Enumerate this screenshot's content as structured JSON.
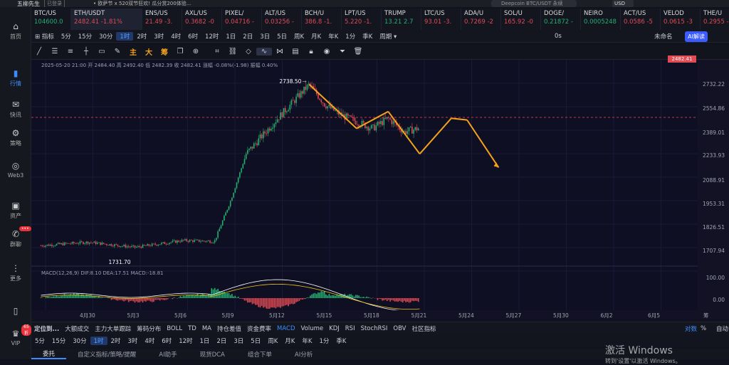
{
  "topbar": {
    "user": "五柳先生",
    "status": "已登录",
    "notice": "• 欧萨节 x 520双节狂欢! 瓜分赏200体验...",
    "search_placeholder": "Deepcoin BTC/USDT 永续",
    "currency": "USD"
  },
  "sidebar": {
    "items": [
      {
        "label": "首页",
        "icon": "home-icon"
      },
      {
        "label": "行情",
        "icon": "market-icon"
      },
      {
        "label": "快讯",
        "icon": "news-icon"
      },
      {
        "label": "策略",
        "icon": "strategy-icon"
      },
      {
        "label": "Web3",
        "icon": "web3-icon"
      },
      {
        "label": "资产",
        "icon": "wallet-icon"
      },
      {
        "label": "群聊",
        "icon": "chat-icon",
        "badge": "•••"
      },
      {
        "label": "更多",
        "icon": "more-icon"
      },
      {
        "label": "",
        "icon": "phone-icon"
      },
      {
        "label": "VIP",
        "icon": "vip-icon",
        "badge": "65折"
      }
    ]
  },
  "tickers": [
    {
      "name": "BTC/US",
      "value": "104600.0",
      "dir": "up"
    },
    {
      "name": "ETH/USDT",
      "value": "2482.41  -1.81%",
      "dir": "dn",
      "selected": true
    },
    {
      "name": "ENS/US",
      "value": "21.49 -3.",
      "dir": "dn"
    },
    {
      "name": "AXL/US",
      "value": "0.3682 -0",
      "dir": "dn"
    },
    {
      "name": "PIXEL/",
      "value": "0.04716 -",
      "dir": "dn"
    },
    {
      "name": "ALT/US",
      "value": "0.03256 -",
      "dir": "dn"
    },
    {
      "name": "BCH/U",
      "value": "386.8 -1.",
      "dir": "dn"
    },
    {
      "name": "LPT/US",
      "value": "5.220 -1.",
      "dir": "dn"
    },
    {
      "name": "TRUMP",
      "value": "13.21 2.7",
      "dir": "up"
    },
    {
      "name": "LTC/US",
      "value": "93.01 -3.",
      "dir": "dn"
    },
    {
      "name": "ADA/U",
      "value": "0.7269 -2",
      "dir": "dn"
    },
    {
      "name": "SOL/U",
      "value": "165.92 -0",
      "dir": "dn"
    },
    {
      "name": "DOGE/",
      "value": "0.21872 -",
      "dir": "up"
    },
    {
      "name": "NEIRO",
      "value": "0.0005248",
      "dir": "up"
    },
    {
      "name": "ACT/US",
      "value": "0.0586 -5",
      "dir": "dn"
    },
    {
      "name": "VELOD",
      "value": "0.0615 -3",
      "dir": "dn"
    },
    {
      "name": "THE/U",
      "value": "0.2955 -2",
      "dir": "dn"
    }
  ],
  "timebar": {
    "items": [
      "指标",
      "5分",
      "15分",
      "30分",
      "1时",
      "2时",
      "3时",
      "4时",
      "6时",
      "12时",
      "1日",
      "2日",
      "3日",
      "5日",
      "周K",
      "月K",
      "年K",
      "1分",
      "季K"
    ],
    "active": "1时",
    "period": "周期",
    "right": [
      "0s",
      "未命名"
    ],
    "ai": "AI解读"
  },
  "toolbar": {
    "text_tools": [
      "主",
      "大",
      "筹"
    ]
  },
  "chart": {
    "info": "2025-05-20 21:00  开 2484.40  高 2492.40  低 2482.39  收 2482.41  涨幅 -0.08%(-1.98)  振幅 0.40%",
    "high_label": "2738.50",
    "low_label": "1731.70",
    "price_tag": "2482.41",
    "macd": "MACD(12,26,9)  DIF:8.10  DEA:17.51  MACD:-18.81",
    "y_labels": [
      "2732.22",
      "2554.86",
      "2389.01",
      "2233.93",
      "2088.91",
      "1953.31",
      "1826.51",
      "1707.94"
    ],
    "macd_y_labels": [
      "100.00",
      "0.00"
    ],
    "x_labels": [
      "4月30",
      "5月3",
      "5月6",
      "5月9",
      "5月12",
      "5月15",
      "5月18",
      "5月21",
      "5月24",
      "5月27",
      "5月30",
      "6月2",
      "6月5"
    ],
    "x_right": "筹"
  },
  "chart_data": {
    "type": "line",
    "title": "",
    "series": [
      {
        "name": "ETH/USDT",
        "x": [
          "4月27",
          "4月30",
          "5月3",
          "5月6",
          "5月8",
          "5月9",
          "5月10",
          "5月12",
          "5月14",
          "5月15",
          "5月16",
          "5月18",
          "5月19",
          "5月20",
          "5月21"
        ],
        "values": [
          1790,
          1810,
          1780,
          1820,
          1815,
          2050,
          2330,
          2540,
          2738.5,
          2620,
          2560,
          2480,
          2540,
          2460,
          2482.41
        ]
      }
    ],
    "projection": {
      "name": "",
      "x": [
        "5月14",
        "5月17",
        "5月19",
        "5月21",
        "5月23",
        "5月24",
        "5月26"
      ],
      "values": [
        2738.5,
        2480,
        2580,
        2330,
        2540,
        2530,
        2250
      ]
    },
    "ylim": [
      1690,
      2780
    ],
    "grid": true
  },
  "indicators": {
    "items": [
      "定位到...",
      "大额成交",
      "主力大单跟踪",
      "筹码分布",
      "BOLL",
      "TD",
      "MA",
      "持仓差值",
      "资金费率",
      "MACD",
      "Volume",
      "KDJ",
      "RSI",
      "StochRSI",
      "OBV",
      "社区指标"
    ],
    "active": "MACD",
    "right": [
      "对数",
      "%",
      "自动"
    ]
  },
  "bottom_periods": [
    "5分",
    "15分",
    "30分",
    "1时",
    "2时",
    "3时",
    "4时",
    "6时",
    "12时",
    "1日",
    "2日",
    "3日",
    "5日",
    "周K",
    "月K",
    "年K",
    "1分",
    "季K"
  ],
  "bottom_active": "1时",
  "bottom_tabs": [
    "委托",
    "自定义指标/策略/提醒",
    "AI助手",
    "现货DCA",
    "组合下单",
    "AI分析"
  ],
  "watermark": {
    "title": "激活 Windows",
    "sub": "转到'设置'以激活 Windows。"
  }
}
